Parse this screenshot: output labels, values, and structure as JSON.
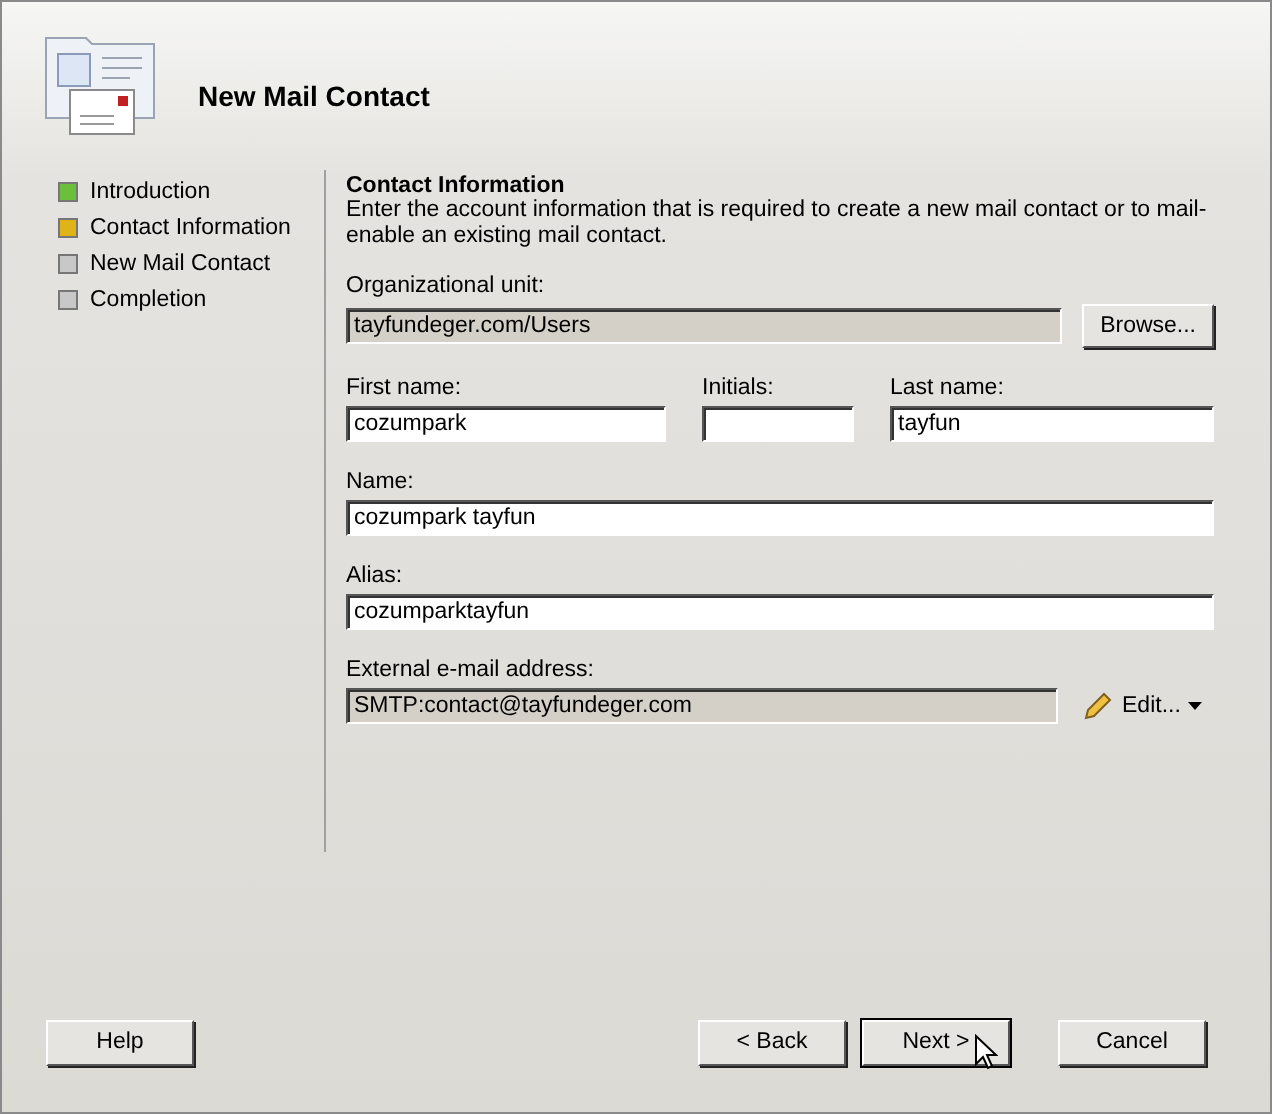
{
  "window": {
    "title": "New Mail Contact"
  },
  "steps": [
    {
      "label": "Introduction",
      "kind": "done"
    },
    {
      "label": "Contact Information",
      "kind": "current"
    },
    {
      "label": "New Mail Contact",
      "kind": "pending"
    },
    {
      "label": "Completion",
      "kind": "pending"
    }
  ],
  "section": {
    "title": "Contact Information",
    "description": "Enter the account information that is required to create a new mail contact or to mail-enable an existing mail contact."
  },
  "rows": [
    [
      {
        "label": "Organizational unit:",
        "value": "tayfundeger.com/Users",
        "readonly": true,
        "action": {
          "kind": "button",
          "label": "Browse..."
        }
      }
    ],
    [
      {
        "label": "First name:",
        "value": "cozumpark",
        "readonly": false
      },
      {
        "label": "Initials:",
        "readonly": false
      },
      {
        "label": "Last name:",
        "value": "tayfun",
        "readonly": false
      }
    ],
    [
      {
        "label": "Name:",
        "value": "cozumpark tayfun",
        "readonly": false
      }
    ],
    [
      {
        "label": "Alias:",
        "value": "cozumparktayfun",
        "readonly": false
      }
    ],
    [
      {
        "label": "External e-mail address:",
        "value": "SMTP:contact@tayfundeger.com",
        "readonly": true,
        "action": {
          "kind": "menu",
          "label": "Edit..."
        }
      }
    ]
  ],
  "buttons": [
    {
      "label": "Help",
      "default": false
    },
    {
      "label": "< Back",
      "default": false
    },
    {
      "label": "Next >",
      "default": true
    },
    {
      "label": "Cancel",
      "default": false
    }
  ]
}
